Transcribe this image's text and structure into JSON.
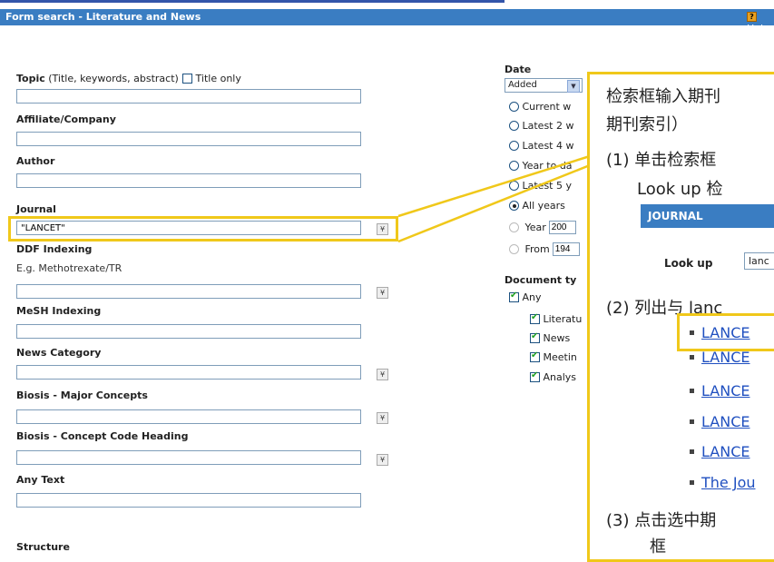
{
  "header": {
    "title": "Form search - Literature and News",
    "help_label": "Help",
    "help_icon": "?"
  },
  "form": {
    "topic_label": "Topic",
    "topic_sub": " (Title, keywords, abstract)",
    "title_only_label": "Title only",
    "topic_value": "",
    "affiliate_label": "Affiliate/Company",
    "affiliate_value": "",
    "author_label": "Author",
    "author_value": "",
    "journal_label": "Journal",
    "journal_value": "\"LANCET\"",
    "ddf_label": "DDF Indexing",
    "ddf_hint": "E.g. Methotrexate/TR",
    "ddf_value": "",
    "mesh_label": "MeSH Indexing",
    "mesh_value": "",
    "news_category_label": "News Category",
    "news_category_value": "",
    "biosis_major_label": "Biosis - Major Concepts",
    "biosis_major_value": "",
    "biosis_code_label": "Biosis - Concept Code Heading",
    "biosis_code_value": "",
    "any_text_label": "Any Text",
    "any_text_value": "",
    "structure_label": "Structure",
    "picker_glyph": "¥"
  },
  "date": {
    "label": "Date",
    "select_value": "Added",
    "options": [
      "Current w",
      "Latest 2 w",
      "Latest 4 w",
      "Year to da",
      "Latest 5 y",
      "All years"
    ],
    "year_label": "Year",
    "year_value": "200",
    "from_label": "From",
    "from_value": "194"
  },
  "doctype": {
    "label": "Document ty",
    "any_label": "Any",
    "items": [
      "Literatu",
      "News",
      "Meetin",
      "Analys"
    ]
  },
  "callout": {
    "line1": "检索框输入期刊",
    "line2": "期刊索引）",
    "step1": "(1) 单击检索框",
    "step1b": "Look up 检",
    "journal_bar": "JOURNAL",
    "lookup_label": "Look up",
    "lookup_value": "lanc",
    "step2": "(2) 列出与 lanc",
    "results": [
      "LANCE",
      "LANCE",
      "LANCE",
      "LANCE",
      "LANCE",
      "The Jou"
    ],
    "step3": "(3) 点击选中期",
    "step3b": "框"
  },
  "colors": {
    "title_bar": "#3a7dc2",
    "highlight": "#f0c81a",
    "link": "#2050c0"
  }
}
